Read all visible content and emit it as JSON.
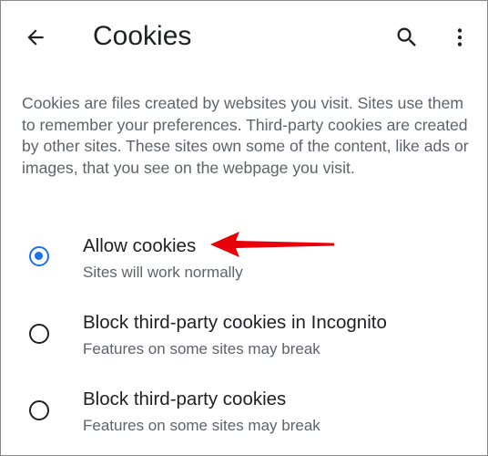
{
  "app_bar": {
    "title": "Cookies",
    "back_icon": "arrow-left-icon",
    "search_icon": "search-icon",
    "menu_icon": "more-vert-icon"
  },
  "description": "Cookies are files created by websites you visit. Sites use them to remember your preferences. Third-party cookies are created by other sites. These sites own some of the content, like ads or images, that you see on the webpage you visit.",
  "options": [
    {
      "label": "Allow cookies",
      "sublabel": "Sites will work normally",
      "selected": true
    },
    {
      "label": "Block third-party cookies in Incognito",
      "sublabel": "Features on some sites may break",
      "selected": false
    },
    {
      "label": "Block third-party cookies",
      "sublabel": "Features on some sites may break",
      "selected": false
    }
  ],
  "colors": {
    "accent": "#1a73e8",
    "text_primary": "#202124",
    "text_secondary": "#5f6368",
    "annotation": "#e8000b"
  },
  "annotation": {
    "icon": "red-arrow-annotation",
    "points_to": "Allow cookies"
  }
}
